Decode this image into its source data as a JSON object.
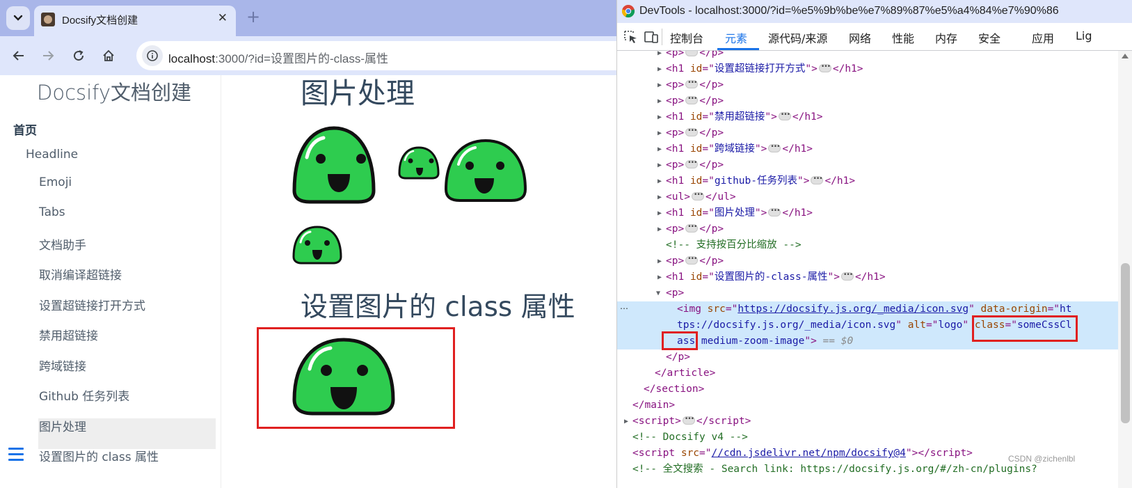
{
  "browser": {
    "tab_title": "Docsify文档创建",
    "tab_close": "✕",
    "new_tab": "+",
    "url_host": "localhost",
    "url_rest": ":3000/?id=设置图片的-class-属性"
  },
  "sidebar": {
    "app_name": "Docsify文档创建",
    "home": "首页",
    "headline": "Headline",
    "items": [
      "Emoji",
      "Tabs",
      "文档助手",
      "取消编译超链接",
      "设置超链接打开方式",
      "禁用超链接",
      "跨域链接",
      "Github 任务列表",
      "图片处理",
      "设置图片的 class 属性"
    ],
    "active_item": "图片处理"
  },
  "content": {
    "heading_images": "图片处理",
    "heading_class": "设置图片的 class 属性",
    "slime_image_alt": "logo"
  },
  "devtools": {
    "title": "DevTools - localhost:3000/?id=%e5%9b%be%e7%89%87%e5%a4%84%e7%90%86",
    "tabs": [
      "控制台",
      "元素",
      "源代码/来源",
      "网络",
      "性能",
      "内存",
      "安全",
      "应用",
      "Lig"
    ],
    "active_tab": "元素",
    "selected_marker": "…",
    "watermark": "CSDN @zichenlbl"
  },
  "dom": {
    "p": "p",
    "h1": "h1",
    "ul": "ul",
    "id_attr": "id",
    "h1_ids": [
      "设置超链接打开方式",
      "禁用超链接",
      "跨域链接",
      "github-任务列表",
      "图片处理",
      "设置图片的-class-属性"
    ],
    "comment_zoom": "<!-- 支持按百分比缩放 -->",
    "img_src": "https://docsify.js.org/_media/icon.svg",
    "img_data_origin_1": "ht",
    "img_data_origin_2": "tps://docsify.js.org/_media/icon.svg",
    "img_alt": "logo",
    "img_class_1": "someCssCl",
    "img_class_2": "ass",
    "img_class_rest": " medium-zoom-image",
    "dollar0": "== $0",
    "close_p": "</p>",
    "close_article": "</article>",
    "close_section": "</section>",
    "close_main": "</main>",
    "comment_docsify": "<!-- Docsify v4 -->",
    "script_src": "//cdn.jsdelivr.net/npm/docsify@4",
    "comment_search": "<!-- 全文搜索 - Search link: https://docsify.js.org/#/zh-cn/plugins?"
  }
}
